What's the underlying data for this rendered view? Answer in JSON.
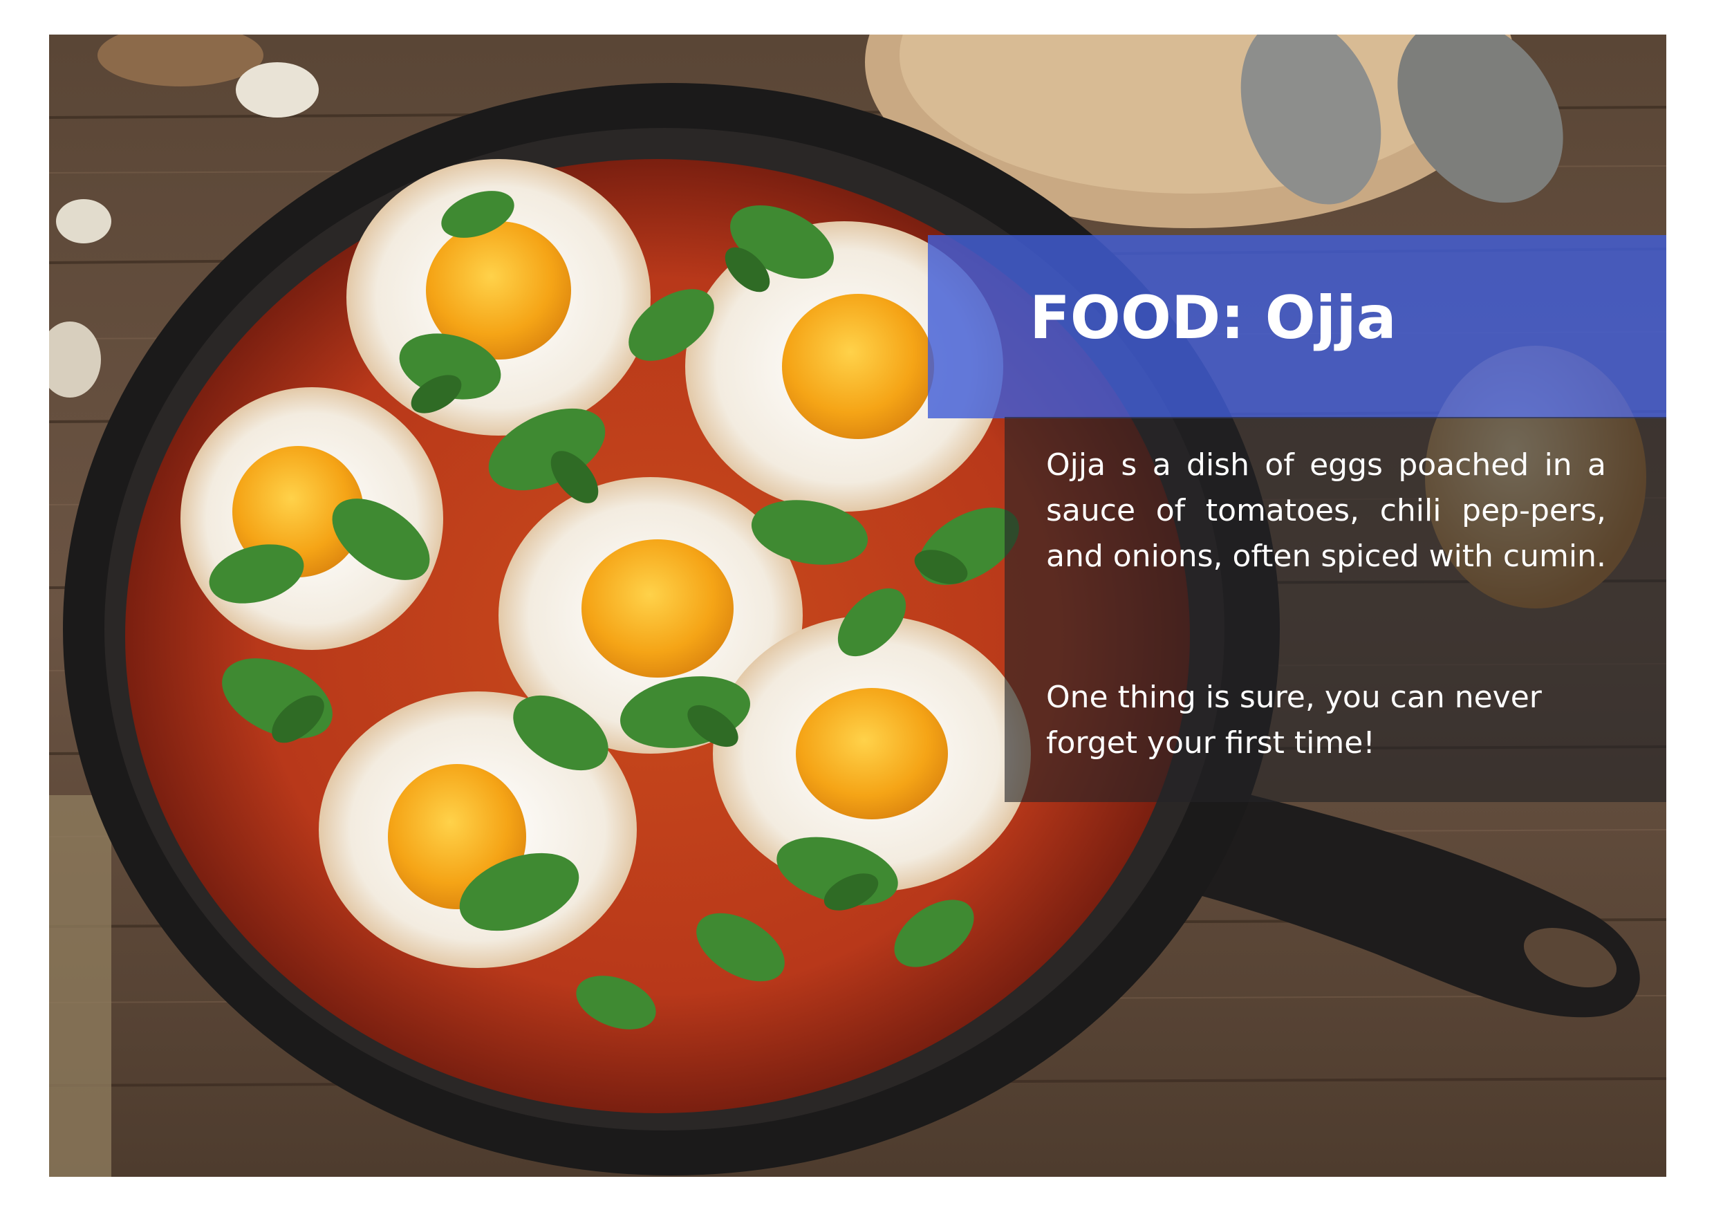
{
  "card": {
    "title": "FOOD: Ojja",
    "paragraph_1": "Ojja s a dish of eggs poached in a sauce of tomatoes, chili pep-pers, and onions, often spiced with cumin.",
    "paragraph_2": "One thing is sure, you can never forget your first time!"
  },
  "photo": {
    "subject": "Ojja (shakshuka) in a cast-iron skillet on a wooden table"
  },
  "colors": {
    "title_band": "#425ED7",
    "description_box": "#232326",
    "text": "#FFFFFF",
    "background": "#FFFFFF"
  }
}
